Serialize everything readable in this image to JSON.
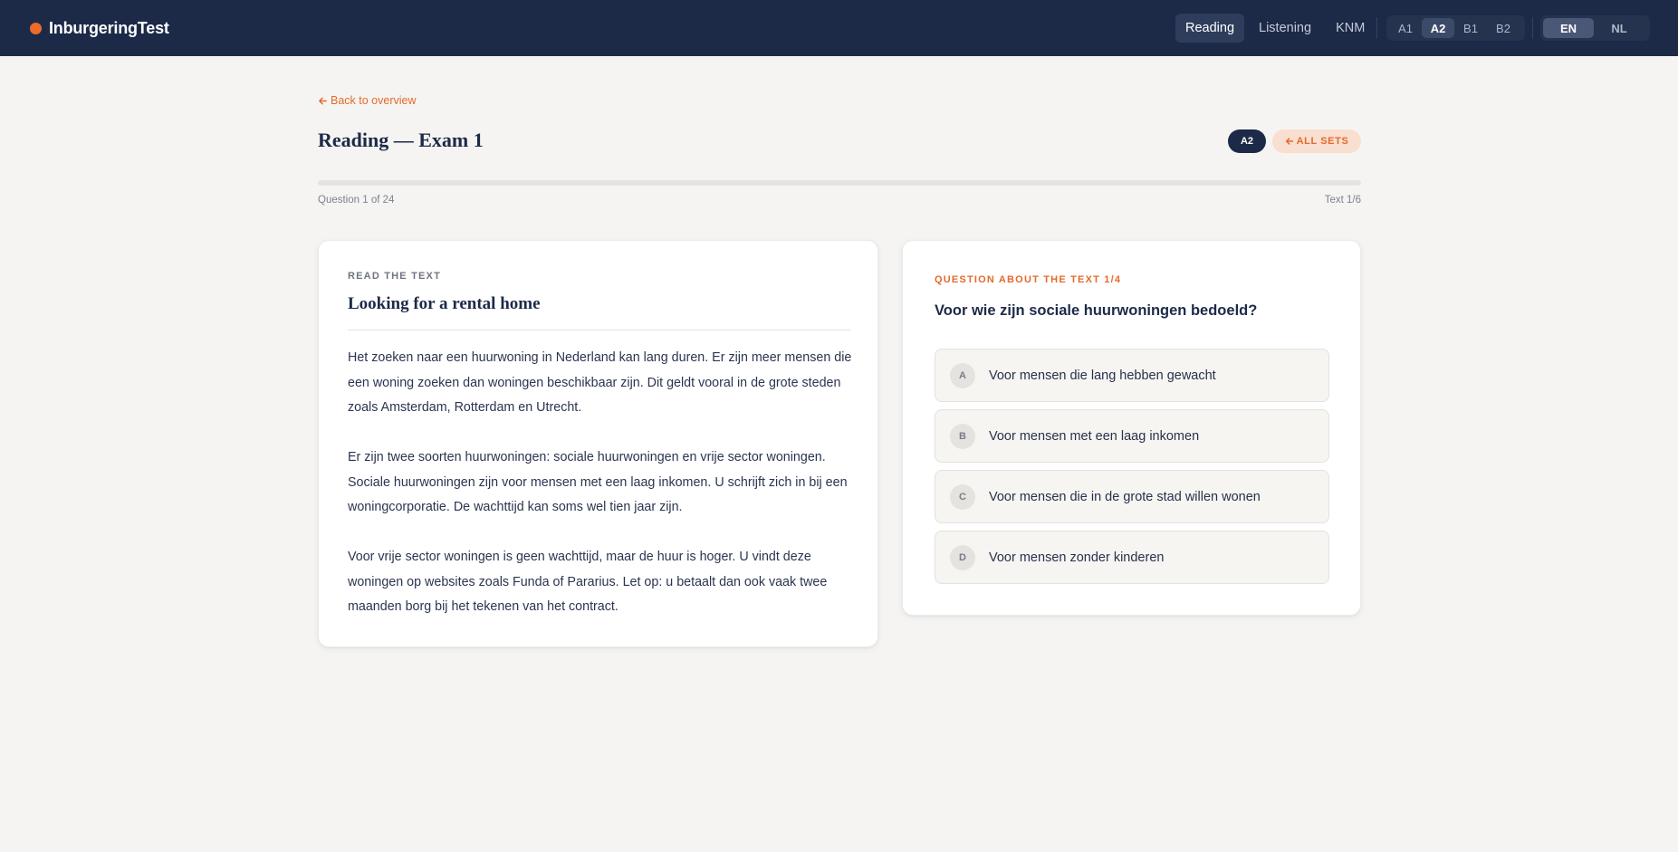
{
  "app": {
    "name": "InburgeringTest",
    "accent": "#ec6c2b",
    "navy": "#1c2a48"
  },
  "nav": {
    "items": [
      {
        "label": "Reading",
        "active": true
      },
      {
        "label": "Listening",
        "active": false
      },
      {
        "label": "KNM",
        "active": false
      }
    ],
    "levels": [
      {
        "label": "A1",
        "active": false
      },
      {
        "label": "A2",
        "active": true
      },
      {
        "label": "B1",
        "active": false
      },
      {
        "label": "B2",
        "active": false
      }
    ],
    "languages": [
      {
        "label": "EN",
        "active": true
      },
      {
        "label": "NL",
        "active": false
      }
    ]
  },
  "header": {
    "back_link": "Back to overview",
    "back_icon": "arrow-left-icon",
    "title": "Reading — Exam 1",
    "level_badge": "A2",
    "all_sets": "ALL SETS"
  },
  "progress": {
    "question_label": "Question 1 of 24",
    "text_label": "Text 1/6",
    "fraction": 0.0
  },
  "text_card": {
    "eyebrow": "READ THE TEXT",
    "heading": "Looking for a rental home",
    "paragraphs": [
      "Het zoeken naar een huurwoning in Nederland kan lang duren. Er zijn meer mensen die een woning zoeken dan woningen beschikbaar zijn. Dit geldt vooral in de grote steden zoals Amsterdam, Rotterdam en Utrecht.",
      "Er zijn twee soorten huurwoningen: sociale huurwoningen en vrije sector woningen. Sociale huurwoningen zijn voor mensen met een laag inkomen. U schrijft zich in bij een woningcorporatie. De wachttijd kan soms wel tien jaar zijn.",
      "Voor vrije sector woningen is geen wachttijd, maar de huur is hoger. U vindt deze woningen op websites zoals Funda of Pararius. Let op: u betaalt dan ook vaak twee maanden borg bij het tekenen van het contract."
    ]
  },
  "question_card": {
    "eyebrow": "QUESTION ABOUT THE TEXT 1/4",
    "question": "Voor wie zijn sociale huurwoningen bedoeld?",
    "options": [
      {
        "letter": "A",
        "text": "Voor mensen die lang hebben gewacht"
      },
      {
        "letter": "B",
        "text": "Voor mensen met een laag inkomen"
      },
      {
        "letter": "C",
        "text": "Voor mensen die in de grote stad willen wonen"
      },
      {
        "letter": "D",
        "text": "Voor mensen zonder kinderen"
      }
    ]
  }
}
